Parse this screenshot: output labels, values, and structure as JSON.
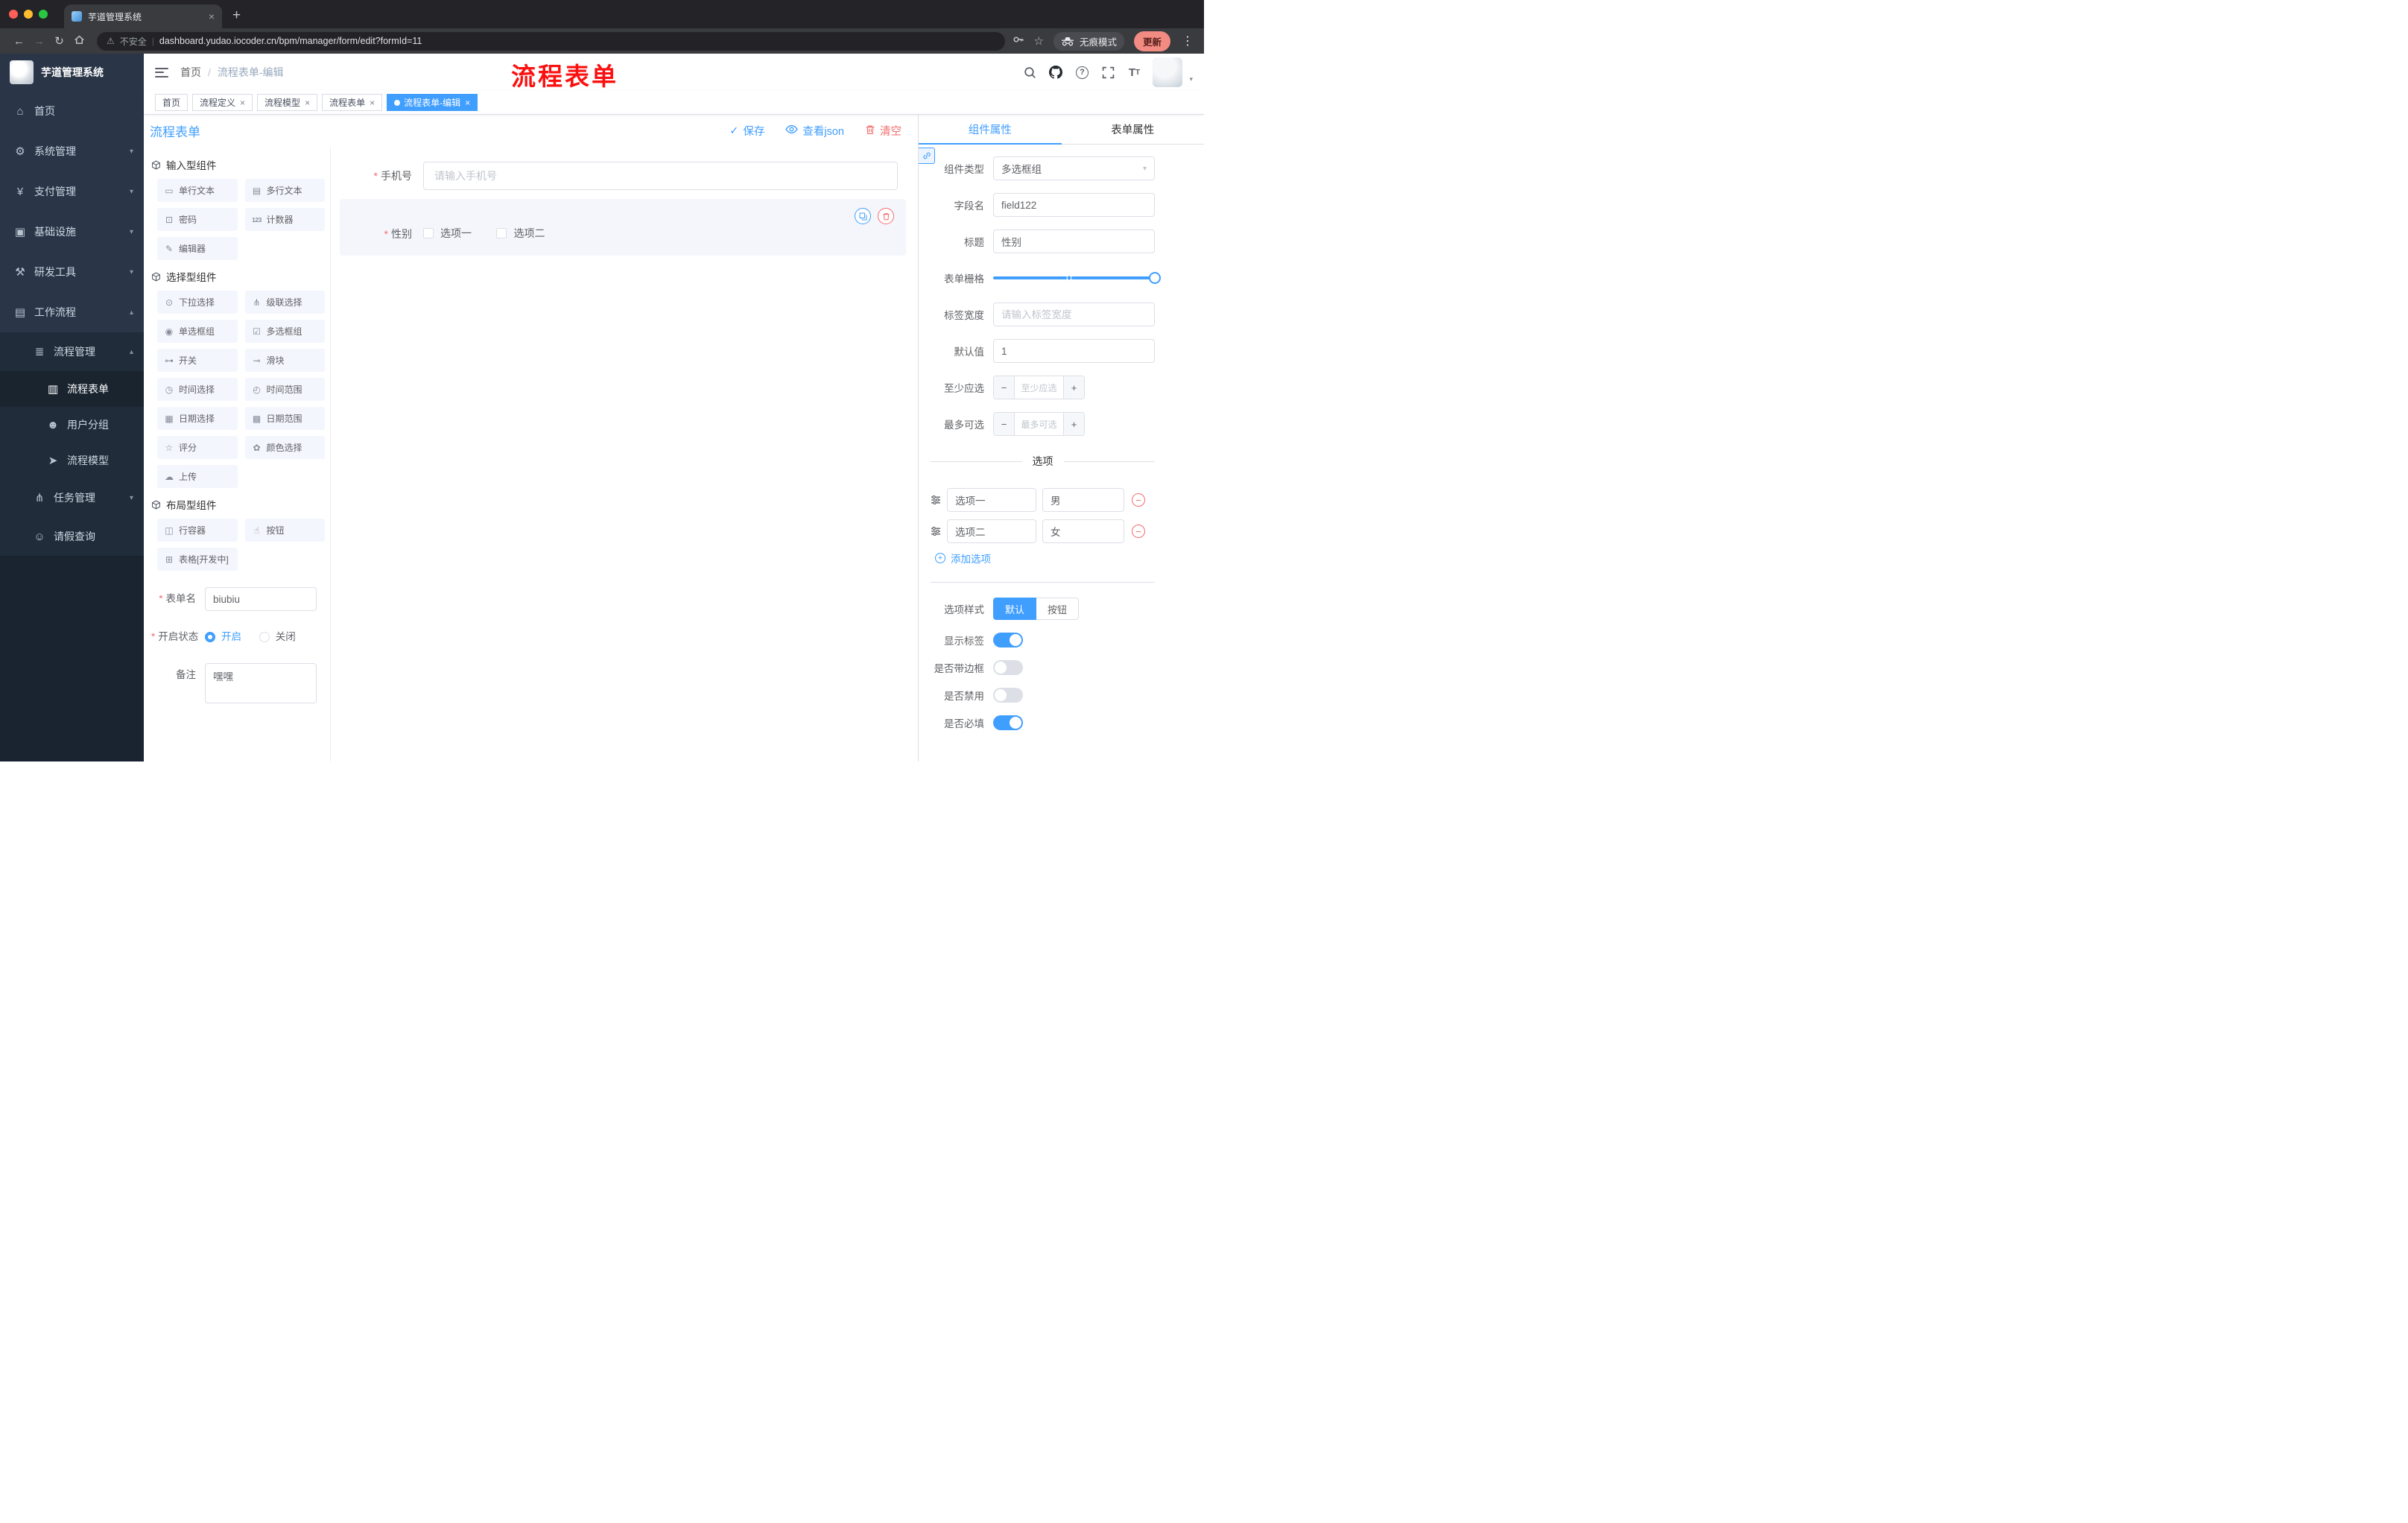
{
  "icons": {
    "close": "×",
    "new_tab": "+",
    "back": "←",
    "forward": "→",
    "reload": "↻",
    "warning": "⚠",
    "pipe": "|",
    "star": "☆",
    "dots": "⋮",
    "caret_down": "▾",
    "check": "✓",
    "minus": "−",
    "plus": "+",
    "question": "?"
  },
  "browser": {
    "tab_title": "芋道管理系统",
    "security_label": "不安全",
    "url": "dashboard.yudao.iocoder.cn/bpm/manager/form/edit?formId=11",
    "incognito_label": "无痕模式",
    "update_label": "更新"
  },
  "annotation": "流程表单",
  "sidebar": {
    "app_title": "芋道管理系统",
    "menu": [
      {
        "label": "首页",
        "icon": "⌂",
        "arrow": ""
      },
      {
        "label": "系统管理",
        "icon": "⚙",
        "arrow": "▾"
      },
      {
        "label": "支付管理",
        "icon": "¥",
        "arrow": "▾"
      },
      {
        "label": "基础设施",
        "icon": "▣",
        "arrow": "▾"
      },
      {
        "label": "研发工具",
        "icon": "⚒",
        "arrow": "▾"
      },
      {
        "label": "工作流程",
        "icon": "▤",
        "arrow": "▴"
      }
    ],
    "submenu": {
      "group": {
        "label": "流程管理",
        "icon": "≣",
        "arrow": "▴"
      },
      "children": [
        {
          "label": "流程表单",
          "icon": "▥"
        },
        {
          "label": "用户分组",
          "icon": "☻"
        },
        {
          "label": "流程模型",
          "icon": "➤"
        }
      ],
      "siblings": [
        {
          "label": "任务管理",
          "icon": "⋔",
          "arrow": "▾"
        },
        {
          "label": "请假查询",
          "icon": "☺",
          "arrow": ""
        }
      ]
    }
  },
  "header": {
    "breadcrumb_root": "首页",
    "breadcrumb_sep": "/",
    "breadcrumb_current": "流程表单-编辑"
  },
  "tags": [
    {
      "label": "首页"
    },
    {
      "label": "流程定义"
    },
    {
      "label": "流程模型"
    },
    {
      "label": "流程表单"
    },
    {
      "label": "流程表单-编辑"
    }
  ],
  "toolbar": {
    "title": "流程表单",
    "save": "保存",
    "view_json": "查看json",
    "clear": "清空"
  },
  "palette": {
    "sections": [
      {
        "title": "输入型组件",
        "items": [
          {
            "label": "单行文本",
            "icon": "▭"
          },
          {
            "label": "多行文本",
            "icon": "▤"
          },
          {
            "label": "密码",
            "icon": "⊡"
          },
          {
            "label": "计数器",
            "icon": "123"
          },
          {
            "label": "编辑器",
            "icon": "✎"
          }
        ]
      },
      {
        "title": "选择型组件",
        "items": [
          {
            "label": "下拉选择",
            "icon": "⊙"
          },
          {
            "label": "级联选择",
            "icon": "⋔"
          },
          {
            "label": "单选框组",
            "icon": "◉"
          },
          {
            "label": "多选框组",
            "icon": "☑"
          },
          {
            "label": "开关",
            "icon": "⊶"
          },
          {
            "label": "滑块",
            "icon": "⊸"
          },
          {
            "label": "时间选择",
            "icon": "◷"
          },
          {
            "label": "时间范围",
            "icon": "◴"
          },
          {
            "label": "日期选择",
            "icon": "▦"
          },
          {
            "label": "日期范围",
            "icon": "▩"
          },
          {
            "label": "评分",
            "icon": "☆"
          },
          {
            "label": "颜色选择",
            "icon": "✿"
          },
          {
            "label": "上传",
            "icon": "☁"
          }
        ]
      },
      {
        "title": "布局型组件",
        "items": [
          {
            "label": "行容器",
            "icon": "◫"
          },
          {
            "label": "按钮",
            "icon": "☝"
          },
          {
            "label": "表格[开发中]",
            "icon": "⊞"
          }
        ]
      }
    ]
  },
  "form_meta": {
    "name_label": "表单名",
    "name_value": "biubiu",
    "status_label": "开启状态",
    "status_on": "开启",
    "status_off": "关闭",
    "remark_label": "备注",
    "remark_value": "嘿嘿"
  },
  "canvas": {
    "phone_label": "手机号",
    "phone_placeholder": "请输入手机号",
    "gender_label": "性别",
    "gender_options": [
      "选项一",
      "选项二"
    ]
  },
  "props": {
    "tab_component": "组件属性",
    "tab_form": "表单属性",
    "component_type_label": "组件类型",
    "component_type_value": "多选框组",
    "field_name_label": "字段名",
    "field_name_value": "field122",
    "title_label": "标题",
    "title_value": "性别",
    "grid_label": "表单栅格",
    "label_width_label": "标签宽度",
    "label_width_placeholder": "请输入标签宽度",
    "default_label": "默认值",
    "default_value": "1",
    "min_label": "至少应选",
    "min_placeholder": "至少应选",
    "max_label": "最多可选",
    "max_placeholder": "最多可选",
    "options_title": "选项",
    "options": [
      {
        "name": "选项一",
        "value": "男"
      },
      {
        "name": "选项二",
        "value": "女"
      }
    ],
    "add_option": "添加选项",
    "option_style_label": "选项样式",
    "option_style_default": "默认",
    "option_style_button": "按钮",
    "show_label_label": "显示标签",
    "border_label": "是否带边框",
    "disabled_label": "是否禁用",
    "required_label": "是否必填"
  },
  "colors": {
    "primary": "#409eff",
    "danger": "#f56c6c",
    "annotation": "#fb1010"
  }
}
